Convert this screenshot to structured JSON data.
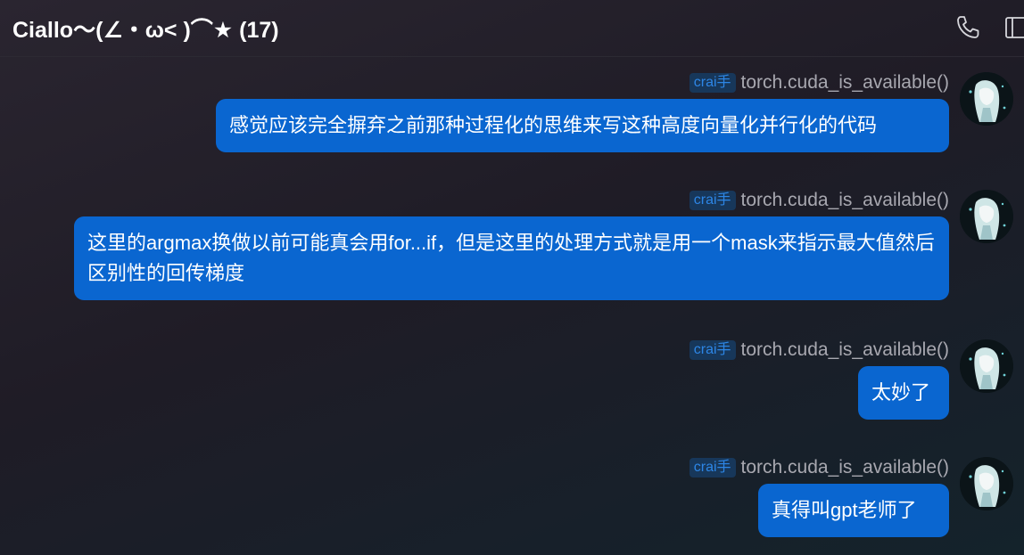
{
  "header": {
    "title": "Ciallo～(∠・ω< )⌒★ (17)",
    "phone_icon": "phone-icon",
    "window_icon": "window-icon"
  },
  "messages": [
    {
      "tag": "crai手",
      "sender": "torch.cuda_is_available()",
      "text": "感觉应该完全摒弃之前那种过程化的思维来写这种高度向量化并行化的代码"
    },
    {
      "tag": "crai手",
      "sender": "torch.cuda_is_available()",
      "text": "这里的argmax换做以前可能真会用for...if，但是这里的处理方式就是用一个mask来指示最大值然后区别性的回传梯度"
    },
    {
      "tag": "crai手",
      "sender": "torch.cuda_is_available()",
      "text": "太妙了"
    },
    {
      "tag": "crai手",
      "sender": "torch.cuda_is_available()",
      "text": "真得叫gpt老师了"
    }
  ],
  "colors": {
    "bubble": "#0a66d0",
    "tag_bg": "#17375a",
    "tag_text": "#2d86e6",
    "sender_text": "#a8a8b0"
  }
}
